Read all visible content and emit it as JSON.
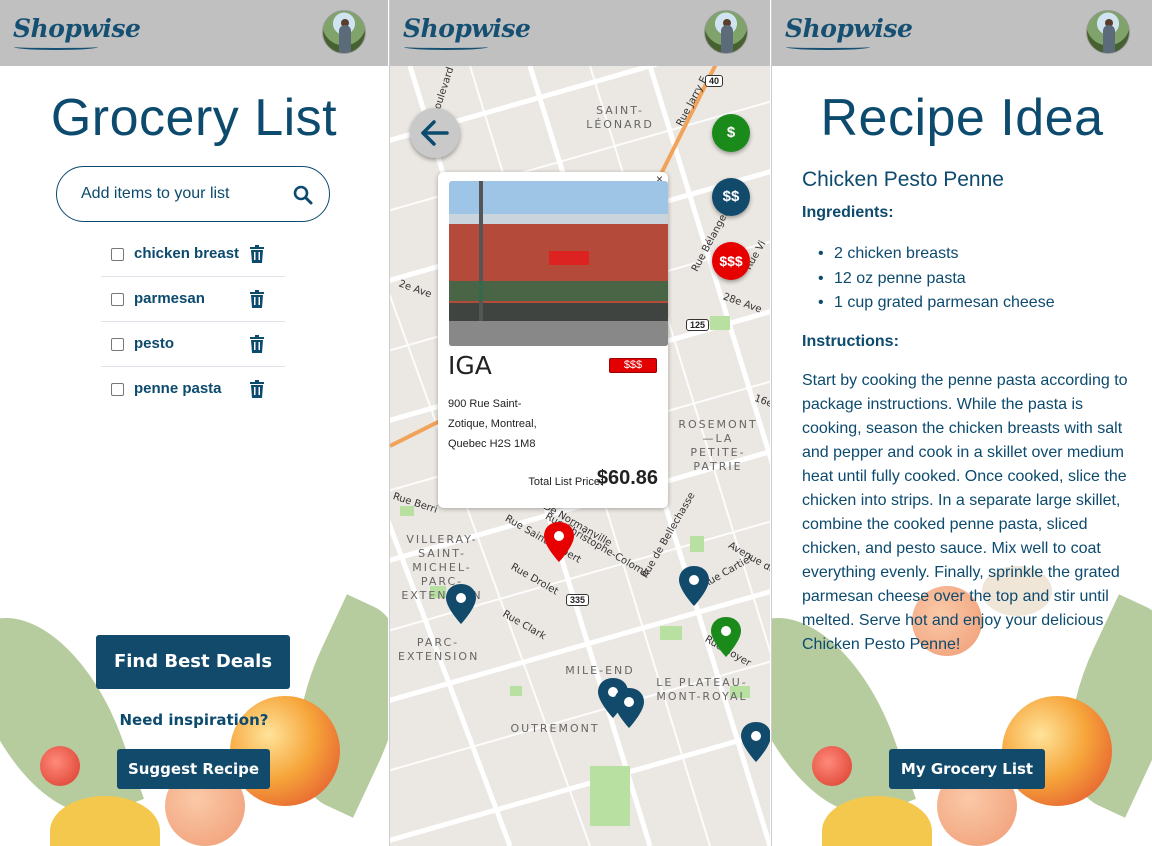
{
  "brand": {
    "name": "Shopwise"
  },
  "grocery": {
    "title": "Grocery List",
    "search_placeholder": "Add items to your list",
    "items": [
      {
        "label": "chicken breast",
        "checked": false
      },
      {
        "label": "parmesan",
        "checked": false
      },
      {
        "label": "pesto",
        "checked": false
      },
      {
        "label": "penne pasta",
        "checked": false
      }
    ],
    "find_deals_label": "Find Best Deals",
    "inspiration_text": "Need inspiration?",
    "suggest_recipe_label": "Suggest Recipe"
  },
  "map": {
    "price_filters": [
      "$",
      "$$",
      "$$$"
    ],
    "filter_colors": {
      "low": "#1a8a1a",
      "mid": "#124a6b",
      "high": "#e60000"
    },
    "store_card": {
      "close": "×",
      "name": "IGA",
      "price_tag": "$$$",
      "address": "900 Rue Saint-Zotique, Montreal, Quebec H2S 1M8",
      "total_label": "Total List Price:",
      "total_value": "$60.86"
    },
    "areas": [
      "SAINT-LÉONARD",
      "ROSEMONT—LA PETITE-PATRIE",
      "VILLERAY-SAINT-MICHEL-PARC-EXTENSION",
      "PARC-EXTENSION",
      "MILE-END",
      "LE PLATEAU-MONT-ROYAL",
      "OUTREMONT"
    ],
    "streets": [
      "Boulevard",
      "Rue Jarry E",
      "Rue Bélanger",
      "Rue Berri",
      "Rue Saint-Hubert",
      "Rue Christophe-Colomb",
      "Rue De Normanville",
      "Rue de Bellechasse",
      "Rue Drolet",
      "Rue Clark",
      "Rue Boyer",
      "Rue Cartier",
      "Avenue des",
      "2e Ave",
      "28e Ave",
      "16e",
      "Rue Vi",
      "Rue B"
    ],
    "shields": [
      "40",
      "125",
      "335"
    ]
  },
  "recipe": {
    "title": "Recipe Idea",
    "name": "Chicken Pesto Penne",
    "ingredients_heading": "Ingredients:",
    "ingredients": [
      "2 chicken breasts",
      "12 oz penne pasta",
      "1 cup grated parmesan cheese"
    ],
    "instructions_heading": "Instructions:",
    "instructions": "Start by cooking the penne pasta according to package instructions. While the pasta is cooking, season the chicken breasts with salt and pepper and cook in a skillet over medium heat until fully cooked. Once cooked, slice the chicken into strips. In a separate large skillet, combine the cooked penne pasta, sliced chicken, and pesto sauce. Mix well to coat everything evenly. Finally, sprinkle the grated parmesan cheese over the top and stir until melted. Serve hot and enjoy your delicious Chicken Pesto Penne!",
    "grocery_list_button": "My Grocery List"
  }
}
